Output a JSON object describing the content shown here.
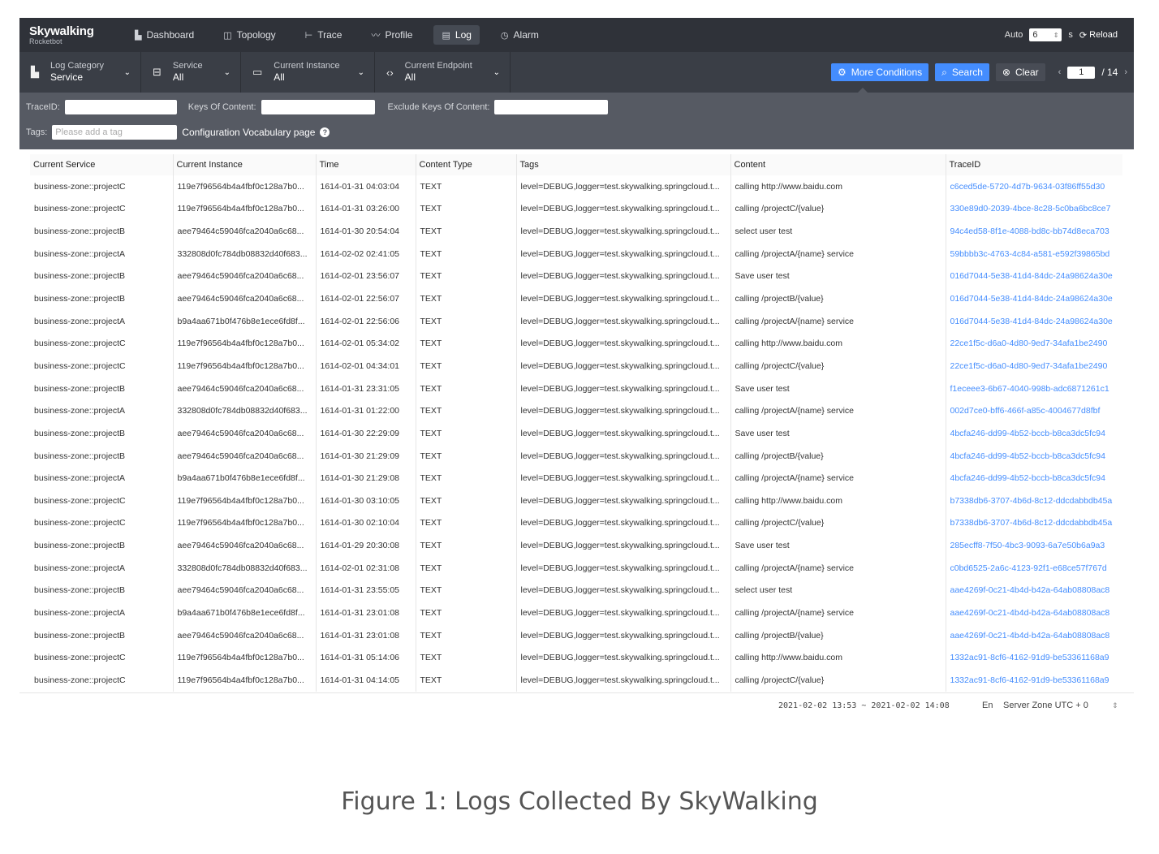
{
  "brand": {
    "name": "Skywalking",
    "sub": "Rocketbot"
  },
  "nav": {
    "items": [
      {
        "label": "Dashboard",
        "icon": "▙",
        "name": "dashboard"
      },
      {
        "label": "Topology",
        "icon": "◫",
        "name": "topology"
      },
      {
        "label": "Trace",
        "icon": "⊢",
        "name": "trace"
      },
      {
        "label": "Profile",
        "icon": "〰",
        "name": "profile"
      },
      {
        "label": "Log",
        "icon": "▤",
        "name": "log",
        "active": true
      },
      {
        "label": "Alarm",
        "icon": "◷",
        "name": "alarm"
      }
    ],
    "auto_label": "Auto",
    "interval_value": "6",
    "seconds_label": "s",
    "reload_label": "Reload"
  },
  "filters": {
    "log_category": {
      "label": "Log Category",
      "value": "Service"
    },
    "service": {
      "label": "Service",
      "value": "All"
    },
    "instance": {
      "label": "Current Instance",
      "value": "All"
    },
    "endpoint": {
      "label": "Current Endpoint",
      "value": "All"
    },
    "more_conditions": "More Conditions",
    "search": "Search",
    "clear": "Clear",
    "page_value": "1",
    "page_total": "/ 14"
  },
  "conditions": {
    "trace_id_label": "TraceID:",
    "keys_label": "Keys Of Content:",
    "exclude_label": "Exclude Keys Of Content:",
    "tags_label": "Tags:",
    "tags_placeholder": "Please add a tag",
    "vocab_label": "Configuration Vocabulary page"
  },
  "table": {
    "headers": [
      "Current Service",
      "Current Instance",
      "Time",
      "Content Type",
      "Tags",
      "Content",
      "TraceID"
    ],
    "rows": [
      [
        "business-zone::projectC",
        "119e7f96564b4a4fbf0c128a7b0...",
        "1614-01-31 04:03:04",
        "TEXT",
        "level=DEBUG,logger=test.skywalking.springcloud.t...",
        "calling http://www.baidu.com",
        "c6ced5de-5720-4d7b-9634-03f86ff55d30"
      ],
      [
        "business-zone::projectC",
        "119e7f96564b4a4fbf0c128a7b0...",
        "1614-01-31 03:26:00",
        "TEXT",
        "level=DEBUG,logger=test.skywalking.springcloud.t...",
        "calling /projectC/{value}",
        "330e89d0-2039-4bce-8c28-5c0ba6bc8ce7"
      ],
      [
        "business-zone::projectB",
        "aee79464c59046fca2040a6c68...",
        "1614-01-30 20:54:04",
        "TEXT",
        "level=DEBUG,logger=test.skywalking.springcloud.t...",
        "select user test",
        "94c4ed58-8f1e-4088-bd8c-bb74d8eca703"
      ],
      [
        "business-zone::projectA",
        "332808d0fc784db08832d40f683...",
        "1614-02-02 02:41:05",
        "TEXT",
        "level=DEBUG,logger=test.skywalking.springcloud.t...",
        "calling /projectA/{name} service",
        "59bbbb3c-4763-4c84-a581-e592f39865bd"
      ],
      [
        "business-zone::projectB",
        "aee79464c59046fca2040a6c68...",
        "1614-02-01 23:56:07",
        "TEXT",
        "level=DEBUG,logger=test.skywalking.springcloud.t...",
        "Save user test",
        "016d7044-5e38-41d4-84dc-24a98624a30e"
      ],
      [
        "business-zone::projectB",
        "aee79464c59046fca2040a6c68...",
        "1614-02-01 22:56:07",
        "TEXT",
        "level=DEBUG,logger=test.skywalking.springcloud.t...",
        "calling /projectB/{value}",
        "016d7044-5e38-41d4-84dc-24a98624a30e"
      ],
      [
        "business-zone::projectA",
        "b9a4aa671b0f476b8e1ece6fd8f...",
        "1614-02-01 22:56:06",
        "TEXT",
        "level=DEBUG,logger=test.skywalking.springcloud.t...",
        "calling /projectA/{name} service",
        "016d7044-5e38-41d4-84dc-24a98624a30e"
      ],
      [
        "business-zone::projectC",
        "119e7f96564b4a4fbf0c128a7b0...",
        "1614-02-01 05:34:02",
        "TEXT",
        "level=DEBUG,logger=test.skywalking.springcloud.t...",
        "calling http://www.baidu.com",
        "22ce1f5c-d6a0-4d80-9ed7-34afa1be2490"
      ],
      [
        "business-zone::projectC",
        "119e7f96564b4a4fbf0c128a7b0...",
        "1614-02-01 04:34:01",
        "TEXT",
        "level=DEBUG,logger=test.skywalking.springcloud.t...",
        "calling /projectC/{value}",
        "22ce1f5c-d6a0-4d80-9ed7-34afa1be2490"
      ],
      [
        "business-zone::projectB",
        "aee79464c59046fca2040a6c68...",
        "1614-01-31 23:31:05",
        "TEXT",
        "level=DEBUG,logger=test.skywalking.springcloud.t...",
        "Save user test",
        "f1eceee3-6b67-4040-998b-adc6871261c1"
      ],
      [
        "business-zone::projectA",
        "332808d0fc784db08832d40f683...",
        "1614-01-31 01:22:00",
        "TEXT",
        "level=DEBUG,logger=test.skywalking.springcloud.t...",
        "calling /projectA/{name} service",
        "002d7ce0-bff6-466f-a85c-4004677d8fbf"
      ],
      [
        "business-zone::projectB",
        "aee79464c59046fca2040a6c68...",
        "1614-01-30 22:29:09",
        "TEXT",
        "level=DEBUG,logger=test.skywalking.springcloud.t...",
        "Save user test",
        "4bcfa246-dd99-4b52-bccb-b8ca3dc5fc94"
      ],
      [
        "business-zone::projectB",
        "aee79464c59046fca2040a6c68...",
        "1614-01-30 21:29:09",
        "TEXT",
        "level=DEBUG,logger=test.skywalking.springcloud.t...",
        "calling /projectB/{value}",
        "4bcfa246-dd99-4b52-bccb-b8ca3dc5fc94"
      ],
      [
        "business-zone::projectA",
        "b9a4aa671b0f476b8e1ece6fd8f...",
        "1614-01-30 21:29:08",
        "TEXT",
        "level=DEBUG,logger=test.skywalking.springcloud.t...",
        "calling /projectA/{name} service",
        "4bcfa246-dd99-4b52-bccb-b8ca3dc5fc94"
      ],
      [
        "business-zone::projectC",
        "119e7f96564b4a4fbf0c128a7b0...",
        "1614-01-30 03:10:05",
        "TEXT",
        "level=DEBUG,logger=test.skywalking.springcloud.t...",
        "calling http://www.baidu.com",
        "b7338db6-3707-4b6d-8c12-ddcdabbdb45a"
      ],
      [
        "business-zone::projectC",
        "119e7f96564b4a4fbf0c128a7b0...",
        "1614-01-30 02:10:04",
        "TEXT",
        "level=DEBUG,logger=test.skywalking.springcloud.t...",
        "calling /projectC/{value}",
        "b7338db6-3707-4b6d-8c12-ddcdabbdb45a"
      ],
      [
        "business-zone::projectB",
        "aee79464c59046fca2040a6c68...",
        "1614-01-29 20:30:08",
        "TEXT",
        "level=DEBUG,logger=test.skywalking.springcloud.t...",
        "Save user test",
        "285ecff8-7f50-4bc3-9093-6a7e50b6a9a3"
      ],
      [
        "business-zone::projectA",
        "332808d0fc784db08832d40f683...",
        "1614-02-01 02:31:08",
        "TEXT",
        "level=DEBUG,logger=test.skywalking.springcloud.t...",
        "calling /projectA/{name} service",
        "c0bd6525-2a6c-4123-92f1-e68ce57f767d"
      ],
      [
        "business-zone::projectB",
        "aee79464c59046fca2040a6c68...",
        "1614-01-31 23:55:05",
        "TEXT",
        "level=DEBUG,logger=test.skywalking.springcloud.t...",
        "select user test",
        "aae4269f-0c21-4b4d-b42a-64ab08808ac8"
      ],
      [
        "business-zone::projectA",
        "b9a4aa671b0f476b8e1ece6fd8f...",
        "1614-01-31 23:01:08",
        "TEXT",
        "level=DEBUG,logger=test.skywalking.springcloud.t...",
        "calling /projectA/{name} service",
        "aae4269f-0c21-4b4d-b42a-64ab08808ac8"
      ],
      [
        "business-zone::projectB",
        "aee79464c59046fca2040a6c68...",
        "1614-01-31 23:01:08",
        "TEXT",
        "level=DEBUG,logger=test.skywalking.springcloud.t...",
        "calling /projectB/{value}",
        "aae4269f-0c21-4b4d-b42a-64ab08808ac8"
      ],
      [
        "business-zone::projectC",
        "119e7f96564b4a4fbf0c128a7b0...",
        "1614-01-31 05:14:06",
        "TEXT",
        "level=DEBUG,logger=test.skywalking.springcloud.t...",
        "calling http://www.baidu.com",
        "1332ac91-8cf6-4162-91d9-be53361168a9"
      ],
      [
        "business-zone::projectC",
        "119e7f96564b4a4fbf0c128a7b0...",
        "1614-01-31 04:14:05",
        "TEXT",
        "level=DEBUG,logger=test.skywalking.springcloud.t...",
        "calling /projectC/{value}",
        "1332ac91-8cf6-4162-91d9-be53361168a9"
      ]
    ]
  },
  "footer": {
    "time_range": "2021-02-02 13:53 ~ 2021-02-02 14:08",
    "language": "En",
    "zone": "Server Zone UTC + 0"
  },
  "caption": "Figure 1: Logs Collected By SkyWalking",
  "colors": {
    "nav_bg": "#2f3239",
    "filter_bg": "#3a3e46",
    "conditions_bg": "#565a63",
    "accent": "#448dfe"
  }
}
